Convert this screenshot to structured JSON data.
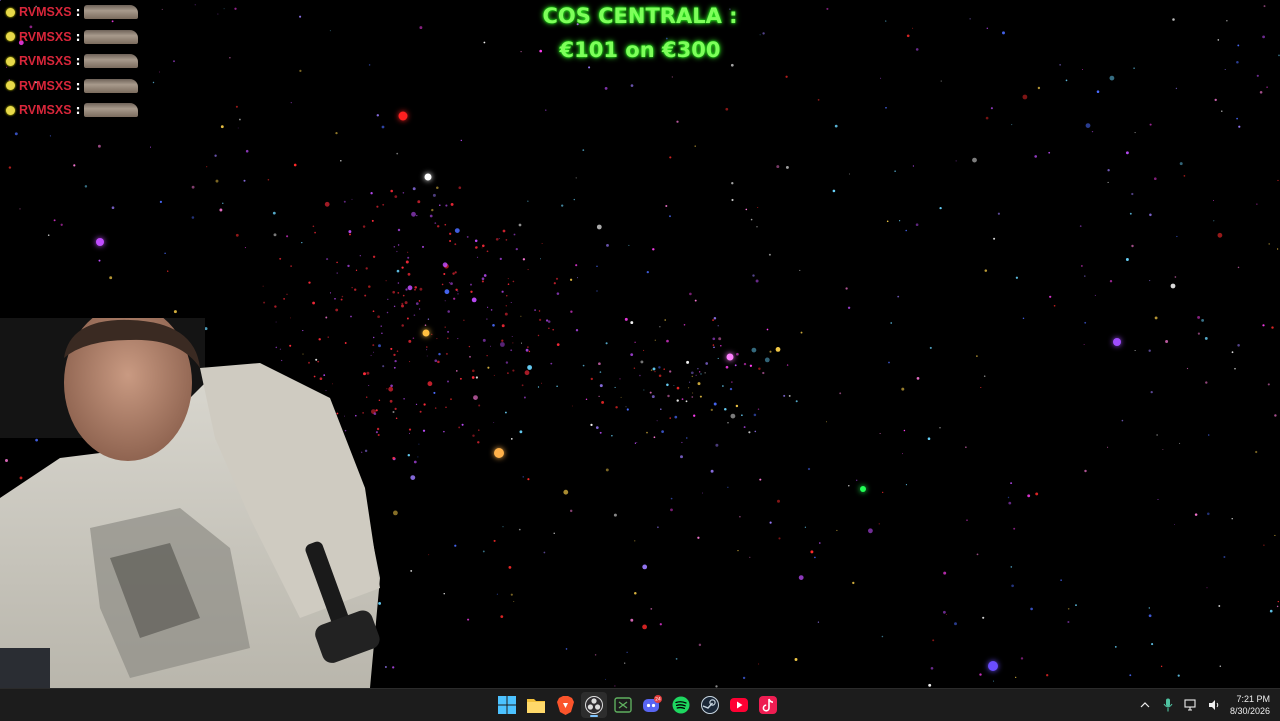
{
  "stream_overlay": {
    "goal_line1": "COS CENTRALA :",
    "goal_line2": "€101 on €300",
    "goal_color": "#7dff5a"
  },
  "chat": {
    "name_color": "#d8263a",
    "messages": [
      {
        "user": "RVMSXS",
        "emote": "tank-emote"
      },
      {
        "user": "RVMSXS",
        "emote": "tank-emote"
      },
      {
        "user": "RVMSXS",
        "emote": "tank-emote"
      },
      {
        "user": "RVMSXS",
        "emote": "tank-emote"
      },
      {
        "user": "RVMSXS",
        "emote": "tank-emote"
      }
    ]
  },
  "taskbar": {
    "apps": [
      {
        "name": "windows-start",
        "icon": "windows-logo-icon"
      },
      {
        "name": "file-explorer",
        "icon": "folder-icon"
      },
      {
        "name": "brave-browser",
        "icon": "brave-lion-icon"
      },
      {
        "name": "obs-studio",
        "icon": "obs-icon",
        "active": true
      },
      {
        "name": "xbox-app",
        "icon": "xbox-icon"
      },
      {
        "name": "discord",
        "icon": "discord-icon",
        "badge": "24"
      },
      {
        "name": "spotify",
        "icon": "spotify-icon"
      },
      {
        "name": "steam",
        "icon": "steam-icon"
      },
      {
        "name": "youtube",
        "icon": "youtube-play-icon"
      },
      {
        "name": "tiktok",
        "icon": "tiktok-icon"
      }
    ],
    "clock_time": "7:21 PM",
    "clock_date": "8/30/2026"
  }
}
